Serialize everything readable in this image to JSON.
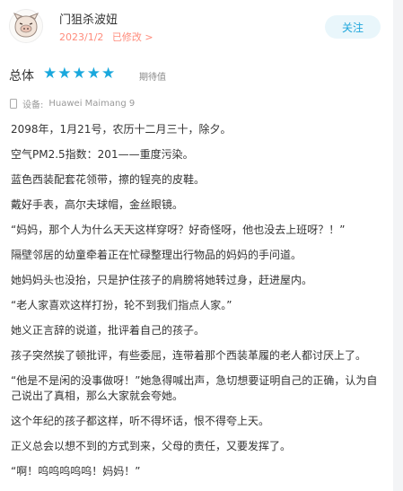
{
  "header": {
    "username": "门狙杀波妞",
    "date": "2023/1/2",
    "modified_label": "已修改 >",
    "follow_label": "关注"
  },
  "rating": {
    "label": "总体",
    "stars": 5,
    "max_stars": 5,
    "text": "期待值"
  },
  "device": {
    "label": "设备:",
    "value": "Huawei Maimang 9"
  },
  "paragraphs": [
    "2098年，1月21号，农历十二月三十，除夕。",
    "空气PM2.5指数：201——重度污染。",
    "蓝色西装配套花领带，擦的锃亮的皮鞋。",
    "戴好手表，高尔夫球帽，金丝眼镜。",
    "“妈妈，那个人为什么天天这样穿呀？好奇怪呀，他也没去上班呀？！”",
    "隔壁邻居的幼童牵着正在忙碌整理出行物品的妈妈的手问道。",
    "她妈妈头也没抬，只是护住孩子的肩膀将她转过身，赶进屋内。",
    "“老人家喜欢这样打扮，轮不到我们指点人家。”",
    "她义正言辞的说道，批评着自己的孩子。",
    "孩子突然挨了顿批评，有些委屈，连带着那个西装革履的老人都讨厌上了。",
    "“他是不是闲的没事做呀！”她急得喊出声，急切想要证明自己的正确，认为自己说出了真相，那么大家就会夸她。",
    "这个年纪的孩子都这样，听不得坏话，恨不得夸上天。",
    "正义总会以想不到的方式到来，父母的责任，又要发挥了。",
    "“啊！呜呜呜呜呜！妈妈！”"
  ]
}
